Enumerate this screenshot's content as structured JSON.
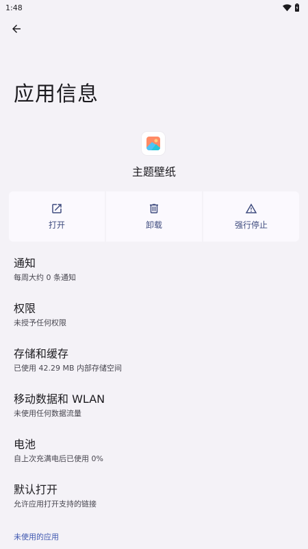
{
  "status_bar": {
    "time": "1:48"
  },
  "header": {
    "title": "应用信息"
  },
  "app": {
    "name": "主题壁纸"
  },
  "actions": [
    {
      "label": "打开",
      "icon": "open-external-icon"
    },
    {
      "label": "卸载",
      "icon": "trash-icon"
    },
    {
      "label": "强行停止",
      "icon": "warning-icon"
    }
  ],
  "settings": [
    {
      "title": "通知",
      "summary": "每周大约 0 条通知"
    },
    {
      "title": "权限",
      "summary": "未授予任何权限"
    },
    {
      "title": "存储和缓存",
      "summary": "已使用 42.29 MB 内部存储空间"
    },
    {
      "title": "移动数据和 WLAN",
      "summary": "未使用任何数据流量"
    },
    {
      "title": "电池",
      "summary": "自上次充满电后已使用 0%"
    },
    {
      "title": "默认打开",
      "summary": "允许应用打开支持的链接"
    }
  ],
  "footer": {
    "link": "未使用的应用"
  },
  "colors": {
    "background": "#f4f2f7",
    "accent": "#3e4b7e",
    "link": "#3e57b0"
  }
}
